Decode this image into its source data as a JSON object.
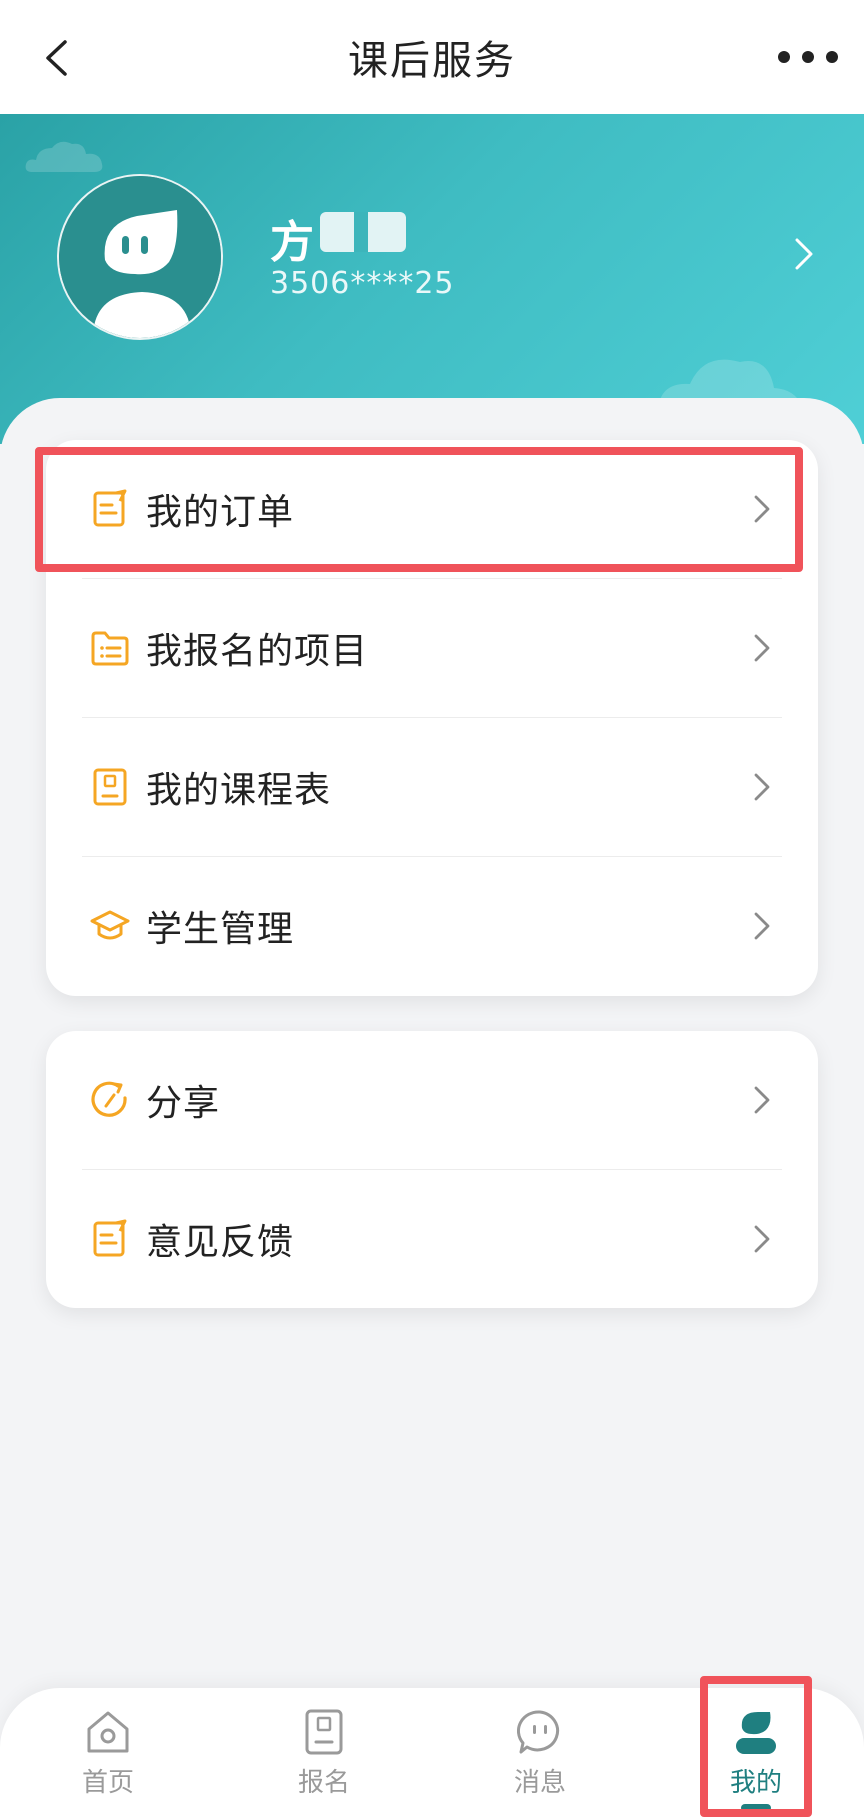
{
  "header": {
    "title": "课后服务"
  },
  "profile": {
    "name": "方",
    "phone": "3506****25"
  },
  "menu_group_1": [
    {
      "label": "我的订单",
      "icon": "order-doc-icon"
    },
    {
      "label": "我报名的项目",
      "icon": "folder-list-icon"
    },
    {
      "label": "我的课程表",
      "icon": "schedule-icon"
    },
    {
      "label": "学生管理",
      "icon": "graduation-cap-icon"
    }
  ],
  "menu_group_2": [
    {
      "label": "分享",
      "icon": "share-icon"
    },
    {
      "label": "意见反馈",
      "icon": "feedback-icon"
    }
  ],
  "tabbar": [
    {
      "label": "首页",
      "icon": "home-icon"
    },
    {
      "label": "报名",
      "icon": "signup-icon"
    },
    {
      "label": "消息",
      "icon": "message-icon"
    },
    {
      "label": "我的",
      "icon": "user-icon",
      "active": true
    }
  ],
  "colors": {
    "accent": "#1f7f80",
    "banner_start": "#2aa2a6",
    "banner_end": "#4fcfd6",
    "icon_yellow": "#f5a623",
    "highlight": "#f0535a"
  }
}
